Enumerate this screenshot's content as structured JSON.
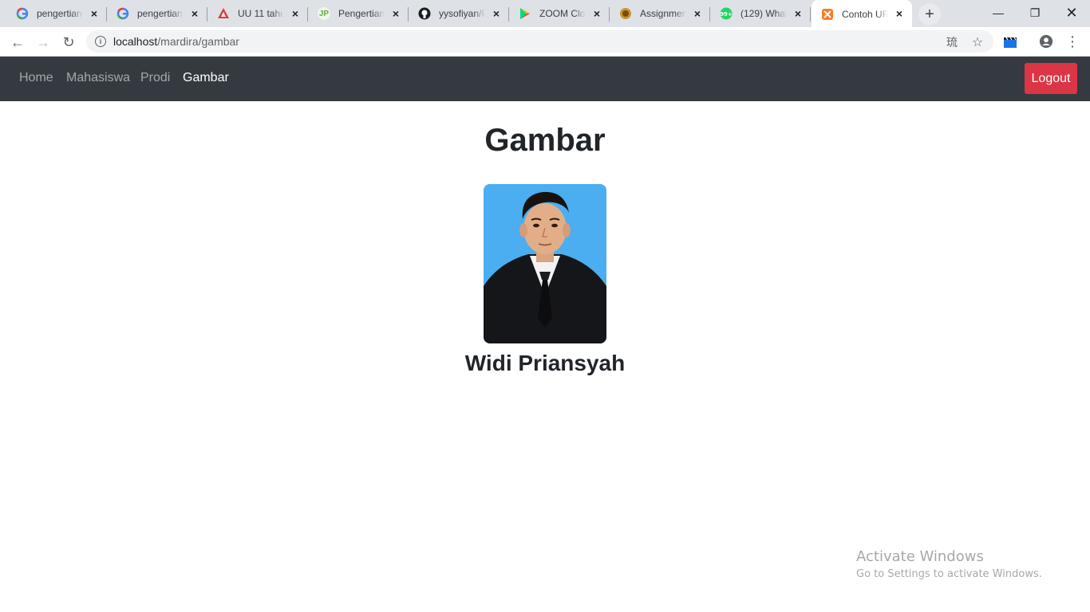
{
  "browser": {
    "tabs": [
      {
        "title": "pengertian",
        "icon": "google-icon"
      },
      {
        "title": "pengertian",
        "icon": "google-icon"
      },
      {
        "title": "UU 11 tahun",
        "icon": "pdf-icon"
      },
      {
        "title": "Pengertian",
        "icon": "jp-icon"
      },
      {
        "title": "yysofiyan/P",
        "icon": "github-icon"
      },
      {
        "title": "ZOOM Cloud",
        "icon": "play-store-icon"
      },
      {
        "title": "Assignment",
        "icon": "campus-icon"
      },
      {
        "title": "(129) Whats",
        "icon": "whatsapp-icon"
      },
      {
        "title": "Contoh URI",
        "icon": "xampp-icon",
        "active": true
      }
    ],
    "url_host": "localhost",
    "url_path": "/mardira/gambar"
  },
  "navbar": {
    "links": [
      "Home",
      "Mahasiswa",
      "Prodi",
      "Gambar"
    ],
    "active": "Gambar",
    "logout_label": "Logout"
  },
  "main": {
    "title": "Gambar",
    "person_name": "Widi Priansyah"
  },
  "watermark": {
    "line1": "Activate Windows",
    "line2": "Go to Settings to activate Windows."
  },
  "colors": {
    "navbar_bg": "#343a40",
    "logout_bg": "#dc3545",
    "photo_bg": "#4aaef0"
  }
}
